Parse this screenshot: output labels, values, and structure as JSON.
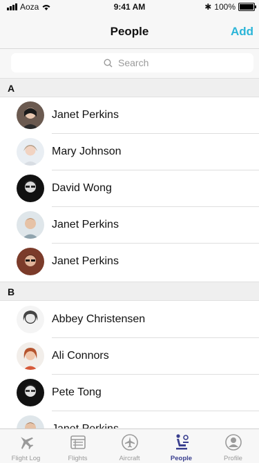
{
  "status_bar": {
    "carrier": "Aoza",
    "time": "9:41 AM",
    "battery": "100%"
  },
  "nav": {
    "title": "People",
    "add_label": "Add"
  },
  "search": {
    "placeholder": "Search"
  },
  "sections": [
    {
      "letter": "A",
      "people": [
        "Janet Perkins",
        "Mary Johnson",
        "David Wong",
        "Janet Perkins",
        "Janet Perkins"
      ]
    },
    {
      "letter": "B",
      "people": [
        "Abbey Christensen",
        "Ali Connors",
        "Pete Tong",
        "Janet Perkins"
      ]
    }
  ],
  "tabs": [
    {
      "label": "Flight Log",
      "icon": "airplane-icon"
    },
    {
      "label": "Flights",
      "icon": "list-icon"
    },
    {
      "label": "Aircraft",
      "icon": "aircraft-circle-icon"
    },
    {
      "label": "People",
      "icon": "people-icon",
      "active": true
    },
    {
      "label": "Profile",
      "icon": "profile-icon"
    }
  ],
  "colors": {
    "accent": "#2bb5d8",
    "active_tab": "#3a3f8f",
    "inactive_tab": "#9a9a9a"
  }
}
